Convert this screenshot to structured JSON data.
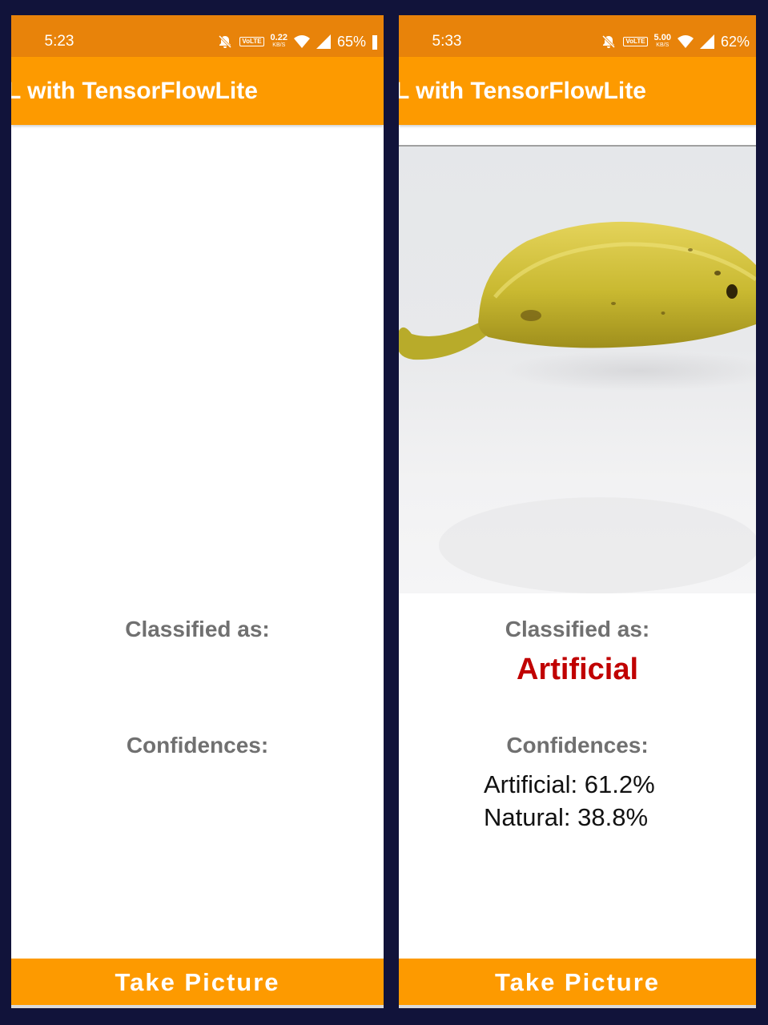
{
  "screens": [
    {
      "status": {
        "time": "5:23",
        "volte": "VoLTE",
        "speed_value": "0.22",
        "speed_unit": "KB/S",
        "battery": "65%"
      },
      "title": "L with TensorFlowLite",
      "classified_label": "Classified as:",
      "result": "",
      "confidences_label": "Confidences:",
      "confidences": [],
      "button_label": "Take Picture"
    },
    {
      "status": {
        "time": "5:33",
        "volte": "VoLTE",
        "speed_value": "5.00",
        "speed_unit": "KB/S",
        "battery": "62%"
      },
      "title": "L with TensorFlowLite",
      "classified_label": "Classified as:",
      "result": "Artificial",
      "confidences_label": "Confidences:",
      "confidences": [
        "Artificial: 61.2%",
        "Natural: 38.8%"
      ],
      "button_label": "Take Picture"
    }
  ],
  "colors": {
    "status_bar": "#e8830a",
    "app_bar": "#fd9a00",
    "result_text": "#c00000",
    "label_text": "#707070",
    "frame_background": "#11133a"
  }
}
